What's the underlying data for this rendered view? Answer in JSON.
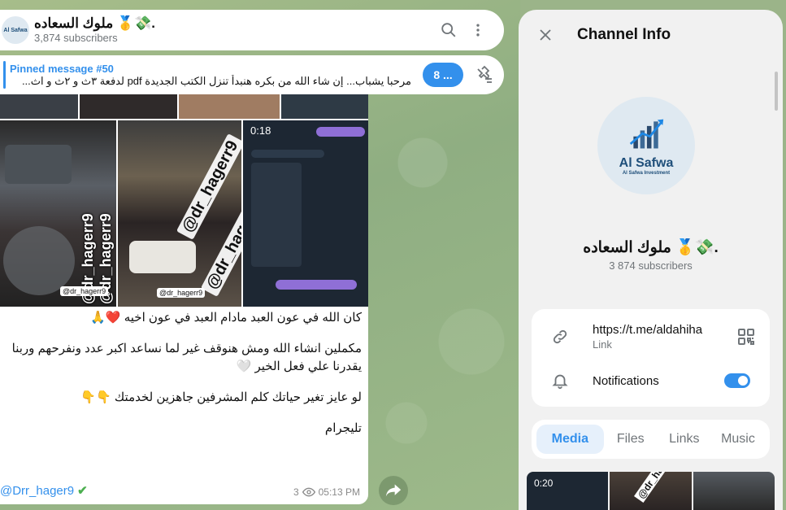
{
  "chat": {
    "title": "ملوك السعاده 🥇💸.",
    "subscribers": "3,874 subscribers",
    "avatar_label": "Al Safwa"
  },
  "pinned": {
    "title": "Pinned message #50",
    "message": "مرحبا يشباب... إن شاء الله من بكره هنبدأ تنزل الكتب الجديدة pdf لدفعة ٣ث و ٢ث و اث...",
    "count": "8 ..."
  },
  "message": {
    "media_duration": "0:18",
    "watermark": "@dr_hagerr9",
    "paragraph1": "كان الله في عون العبد مادام العبد في عون اخيه ❤️🙏",
    "paragraph2": "مكملين انشاء الله ومش هنوقف غير لما نساعد اكبر عدد ونفرحهم وربنا يقدرنا علي فعل الخير 🤍",
    "paragraph3": "لو عايز تغير حياتك كلم المشرفين جاهزين لخدمتك 👇👇",
    "paragraph4": "تليجرام",
    "signature": "@Drr_hager9",
    "signature_mark": "✔",
    "views": "3",
    "time": "05:13 PM"
  },
  "info": {
    "title": "Channel Info",
    "logo_text": "Al Safwa",
    "logo_sub": "Al Safwa Investment",
    "name": "ملوك السعاده 🥇💸.",
    "subscribers": "3 874 subscribers",
    "link": "https://t.me/aldahiha",
    "link_label": "Link",
    "notifications_label": "Notifications",
    "notifications_on": true,
    "tabs": [
      "Media",
      "Files",
      "Links",
      "Music"
    ],
    "strip_duration": "0:20",
    "strip_watermark": "@dr_hag"
  },
  "colors": {
    "accent": "#3390ec",
    "panel_bg": "#f1f1f1",
    "chat_bg": "#9bb489"
  }
}
